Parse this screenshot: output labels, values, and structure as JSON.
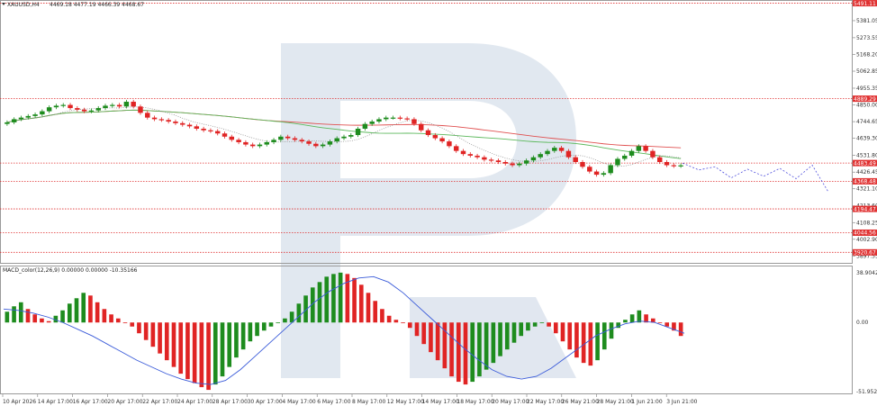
{
  "header": {
    "symbol": "XAUUSD,H4",
    "ohlc": "4469.18 4477.19 4466.39 4468.67"
  },
  "macd_header": "MACD_color(12,26,9) 0.00000 0.00000 -10.35166",
  "colors": {
    "bull": "#1e8c1e",
    "bear": "#e02424",
    "ma_slow": "#e05050",
    "ma_fast": "#5cb85c",
    "ma_dotted": "#888888",
    "projection": "#5050dd",
    "level_line": "#e03030",
    "macd_signal": "#3a5bd9",
    "watermark": "#c9d5e4",
    "badge": "#e03030"
  },
  "price_axis": {
    "labels": [
      "5381.05",
      "5273.55",
      "5168.20",
      "5062.85",
      "4955.35",
      "4850.00",
      "4744.65",
      "4639.30",
      "4531.80",
      "4426.45",
      "4321.10",
      "4213.60",
      "4108.25",
      "4002.90",
      "3897.55"
    ]
  },
  "level_badges": [
    "5491.11",
    "4889.29",
    "4483.49",
    "4368.48",
    "4194.47",
    "4044.56",
    "3920.67"
  ],
  "macd_axis": {
    "top": "38.90427",
    "zero": "0.00",
    "bottom": "-51.95287"
  },
  "time_axis": {
    "labels": [
      "10 Apr 2026",
      "14 Apr 17:00",
      "16 Apr 17:00",
      "20 Apr 17:00",
      "22 Apr 17:00",
      "24 Apr 17:00",
      "28 Apr 17:00",
      "30 Apr 17:00",
      "4 May 17:00",
      "6 May 17:00",
      "8 May 17:00",
      "12 May 17:00",
      "14 May 17:00",
      "18 May 17:00",
      "20 May 17:00",
      "22 May 17:00",
      "26 May 21:00",
      "28 May 21:00",
      "1 Jun 21:00",
      "3 Jun 21:00"
    ]
  },
  "chart_data": {
    "type": "candlestick",
    "symbol": "XAUUSD",
    "timeframe": "H4",
    "y_range": [
      3860,
      5500
    ],
    "horizontal_levels": [
      5491.11,
      4889.29,
      4483.49,
      4368.48,
      4194.47,
      4044.56,
      3920.67
    ],
    "close_series": [
      4740,
      4760,
      4770,
      4780,
      4790,
      4810,
      4835,
      4845,
      4850,
      4830,
      4820,
      4810,
      4815,
      4830,
      4845,
      4850,
      4840,
      4870,
      4840,
      4800,
      4770,
      4760,
      4755,
      4745,
      4735,
      4725,
      4715,
      4700,
      4690,
      4685,
      4670,
      4650,
      4630,
      4615,
      4600,
      4590,
      4600,
      4615,
      4630,
      4650,
      4640,
      4630,
      4620,
      4605,
      4590,
      4600,
      4620,
      4640,
      4650,
      4660,
      4700,
      4730,
      4745,
      4760,
      4770,
      4770,
      4765,
      4760,
      4730,
      4690,
      4660,
      4640,
      4620,
      4590,
      4560,
      4540,
      4530,
      4520,
      4505,
      4500,
      4490,
      4480,
      4470,
      4480,
      4500,
      4520,
      4540,
      4560,
      4580,
      4560,
      4520,
      4490,
      4460,
      4430,
      4410,
      4420,
      4470,
      4510,
      4530,
      4560,
      4590,
      4560,
      4520,
      4490,
      4470,
      4465,
      4469
    ],
    "projection_path": [
      4483,
      4440,
      4460,
      4390,
      4445,
      4400,
      4450,
      4385,
      4470,
      4300
    ],
    "macd": {
      "type": "histogram",
      "range": [
        -51.95287,
        38.90427
      ],
      "histogram": [
        8,
        12,
        15,
        10,
        6,
        3,
        1,
        5,
        9,
        14,
        18,
        22,
        20,
        15,
        10,
        6,
        3,
        0,
        -3,
        -8,
        -13,
        -18,
        -23,
        -28,
        -33,
        -38,
        -42,
        -45,
        -48,
        -50,
        -46,
        -40,
        -33,
        -26,
        -20,
        -14,
        -10,
        -6,
        -3,
        0,
        3,
        8,
        14,
        20,
        26,
        30,
        34,
        36,
        37,
        36,
        33,
        28,
        22,
        16,
        10,
        5,
        2,
        0,
        -4,
        -10,
        -16,
        -22,
        -28,
        -34,
        -40,
        -44,
        -46,
        -44,
        -40,
        -35,
        -30,
        -25,
        -20,
        -15,
        -10,
        -6,
        -3,
        0,
        -3,
        -8,
        -14,
        -20,
        -26,
        -30,
        -32,
        -28,
        -20,
        -12,
        -4,
        2,
        6,
        9,
        6,
        3,
        0,
        -3,
        -6,
        -10
      ],
      "signal": [
        10,
        9,
        7,
        4,
        0,
        -5,
        -10,
        -16,
        -22,
        -28,
        -33,
        -38,
        -42,
        -45,
        -46,
        -43,
        -35,
        -25,
        -15,
        -5,
        5,
        15,
        23,
        29,
        33,
        34,
        30,
        22,
        12,
        2,
        -8,
        -18,
        -27,
        -35,
        -40,
        -42,
        -40,
        -34,
        -26,
        -18,
        -10,
        -5,
        -1,
        1,
        0,
        -4,
        -8
      ]
    }
  }
}
